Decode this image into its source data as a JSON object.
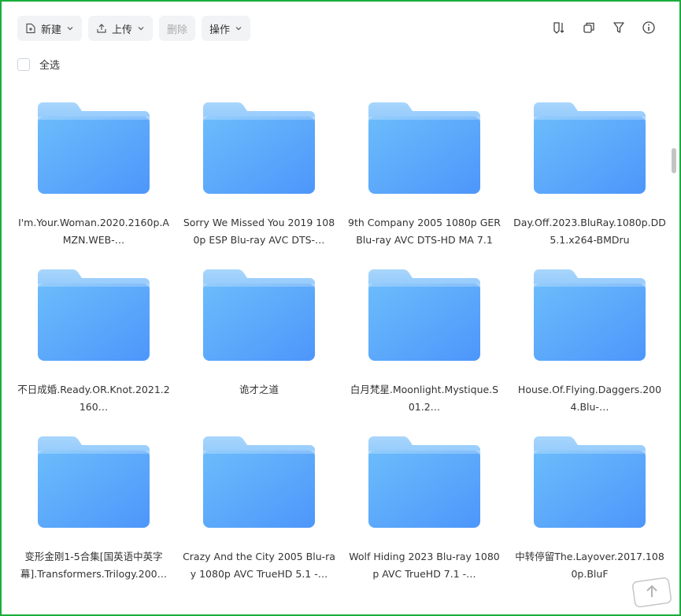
{
  "toolbar": {
    "new_label": "新建",
    "upload_label": "上传",
    "delete_label": "删除",
    "actions_label": "操作"
  },
  "select_all_label": "全选",
  "icons": {
    "new": "new-file-icon",
    "upload": "upload-icon",
    "sort": "sort-icon",
    "copy": "copy-icon",
    "filter": "filter-icon",
    "info": "info-icon"
  },
  "colors": {
    "folder_front": "#57a6fb",
    "folder_back": "#8cc6fb",
    "border": "#1aad3a"
  },
  "files": [
    {
      "name": "I'm.Your.Woman.2020.2160p.AMZN.WEB-…"
    },
    {
      "name": "Sorry We Missed You 2019 1080p ESP Blu-ray AVC DTS-…"
    },
    {
      "name": "9th Company 2005 1080p GER Blu-ray AVC DTS-HD MA 7.1"
    },
    {
      "name": "Day.Off.2023.BluRay.1080p.DD5.1.x264-BMDru"
    },
    {
      "name": "不日成婚.Ready.OR.Knot.2021.2160…"
    },
    {
      "name": "诡才之道"
    },
    {
      "name": "白月梵星.Moonlight.Mystique.S01.2…"
    },
    {
      "name": "House.Of.Flying.Daggers.2004.Blu-…"
    },
    {
      "name": "变形金刚1-5合集[国英语中英字幕].Transformers.Trilogy.200…"
    },
    {
      "name": "Crazy And the City 2005 Blu-ray 1080p AVC TrueHD 5.1 -…"
    },
    {
      "name": "Wolf Hiding 2023 Blu-ray 1080p AVC TrueHD 7.1 -…"
    },
    {
      "name": "中转停留The.Layover.2017.1080p.BluF"
    }
  ]
}
